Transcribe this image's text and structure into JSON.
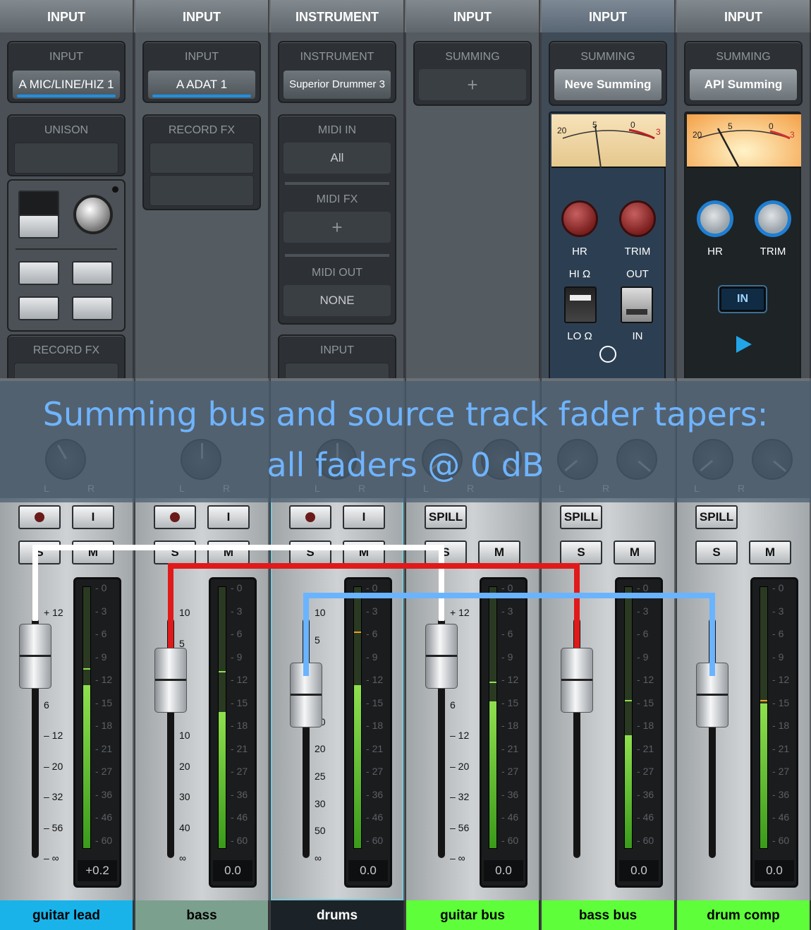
{
  "title": {
    "line1": "Summing bus and source track fader tapers:",
    "line2": "all faders @ 0 dB"
  },
  "colors": {
    "white_route": "#ffffff",
    "red_route": "#e01a1a",
    "blue_route": "#6ab4ff"
  },
  "channels": [
    {
      "header": "INPUT",
      "input_label": "INPUT",
      "input_value": "A MIC/LINE/HIZ 1",
      "name": "guitar lead",
      "name_bg": "#19b3ea",
      "name_fg": "#000000",
      "readout": "+0.2",
      "scale": [
        "+ 12",
        "6",
        "0",
        "6",
        "– 12",
        "– 20",
        "– 32",
        "– 56",
        "– ∞"
      ],
      "meter_fill": 0.62,
      "meter_peak": 0.68,
      "fader_fraction": 0.84
    },
    {
      "header": "INPUT",
      "input_label": "INPUT",
      "input_value": "A ADAT 1",
      "name": "bass",
      "name_bg": "#7ca08e",
      "name_fg": "#000000",
      "readout": "0.0",
      "scale": [
        "10",
        "5",
        "0",
        "5",
        "10",
        "20",
        "30",
        "40",
        "∞"
      ],
      "meter_fill": 0.52,
      "meter_peak": 0.67,
      "fader_fraction": 0.74
    },
    {
      "header": "INSTRUMENT",
      "input_label": "INSTRUMENT",
      "input_value": "Superior Drummer 3",
      "midi_in_label": "MIDI IN",
      "midi_in_value": "All",
      "midi_fx_label": "MIDI FX",
      "midi_out_label": "MIDI OUT",
      "midi_out_value": "NONE",
      "name": "drums",
      "name_bg": "#1c2328",
      "name_fg": "#ffffff",
      "readout": "0.0",
      "scale": [
        "10",
        "5",
        "0",
        "5",
        "10",
        "20",
        "25",
        "30",
        "50",
        "∞"
      ],
      "meter_fill": 0.62,
      "meter_peak": 0.82,
      "fader_fraction": 0.68
    },
    {
      "header": "INPUT",
      "input_label": "SUMMING",
      "name": "guitar bus",
      "name_bg": "#5eff3a",
      "name_fg": "#000000",
      "spill": "SPILL",
      "readout": "0.0",
      "scale": [
        "+ 12",
        "6",
        "0",
        "6",
        "– 12",
        "– 20",
        "– 32",
        "– 56",
        "– ∞"
      ],
      "meter_fill": 0.56,
      "meter_peak": 0.63,
      "fader_fraction": 0.84
    },
    {
      "header": "INPUT",
      "input_label": "SUMMING",
      "input_value": "Neve Summing",
      "name": "bass bus",
      "name_bg": "#5eff3a",
      "name_fg": "#000000",
      "spill": "SPILL",
      "readout": "0.0",
      "knob1": "HR",
      "knob2": "TRIM",
      "sw1_top": "HI Ω",
      "sw1_bot": "LO Ω",
      "sw2_top": "OUT",
      "sw2_bot": "IN",
      "readout_meter_left": "20",
      "readout_meter_mid": "5",
      "readout_meter_right": "0",
      "readout_meter_end": "3",
      "meter_fill": 0.43,
      "meter_peak": 0.56,
      "fader_fraction": 0.74
    },
    {
      "header": "INPUT",
      "input_label": "SUMMING",
      "input_value": "API Summing",
      "name": "drum comp",
      "name_bg": "#5eff3a",
      "name_fg": "#000000",
      "spill": "SPILL",
      "readout": "0.0",
      "knob1": "HR",
      "knob2": "TRIM",
      "in_button": "IN",
      "readout_meter_left": "20",
      "readout_meter_mid": "5",
      "readout_meter_right": "0",
      "readout_meter_end": "3",
      "meter_fill": 0.55,
      "meter_peak": 0.56,
      "fader_fraction": 0.68
    }
  ],
  "labels": {
    "unison": "UNISON",
    "record_fx": "RECORD FX",
    "input_lbl": "INPUT",
    "solo": "S",
    "mute": "M",
    "input_mon": "I",
    "pan_l": "L",
    "pan_r": "R",
    "plus": "+"
  },
  "meter_ticks": [
    "0",
    "3",
    "6",
    "9",
    "12",
    "15",
    "18",
    "21",
    "27",
    "36",
    "46",
    "60"
  ]
}
